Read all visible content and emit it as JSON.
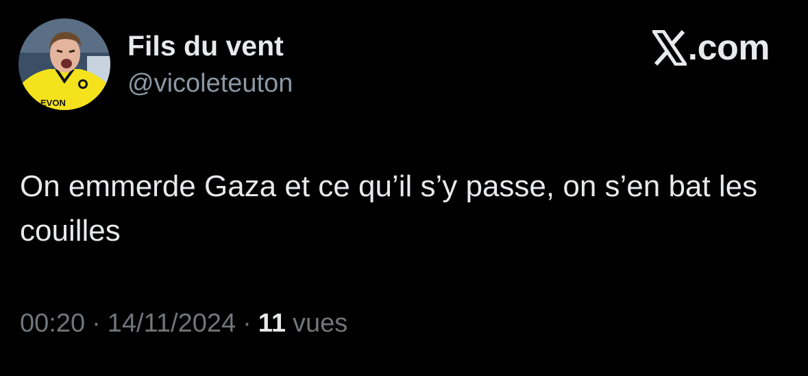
{
  "author": {
    "display_name": "Fils du vent",
    "handle": "@vicoleteuton",
    "avatar_icon": "profile-photo-avatar",
    "avatar_shirt_text": "EVON"
  },
  "brand": {
    "icon": "x-logo-icon",
    "text": ".com"
  },
  "tweet": {
    "text": "On emmerde Gaza et ce qu’il s’y passe, on s’en bat les couilles"
  },
  "meta": {
    "time": "00:20",
    "separator": "·",
    "date": "14/11/2024",
    "views_count": "11",
    "views_label": "vues"
  },
  "colors": {
    "background": "#000000",
    "primary_text": "#e7e9ea",
    "secondary_text": "#71767b",
    "avatar_shirt": "#f3e21c"
  }
}
